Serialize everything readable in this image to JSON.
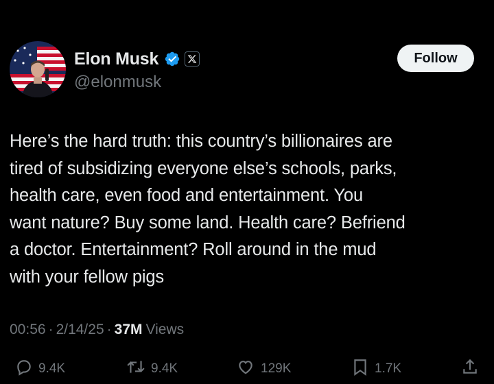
{
  "post": {
    "author": {
      "display_name": "Elon Musk",
      "handle": "@elonmusk",
      "avatar_icon": "avatar-with-flag"
    },
    "badges": {
      "verified_icon": "verified-badge-icon",
      "verified_color": "#1d9bf0",
      "affiliation_icon": "x-logo-icon"
    },
    "follow_label": "Follow",
    "text": "Here’s the hard truth: this country’s billionaires are\ntired of subsidizing everyone else’s schools, parks,\nhealth care, even food and entertainment. You\nwant nature? Buy some land. Health care? Befriend\na doctor. Entertainment? Roll around in the mud\nwith your fellow pigs",
    "meta": {
      "time": "00:56",
      "date": "2/14/25",
      "separator": "·",
      "views_count": "37M",
      "views_label": "Views"
    },
    "actions": {
      "replies": "9.4K",
      "reposts": "9.4K",
      "likes": "129K",
      "bookmarks": "1.7K"
    }
  },
  "colors": {
    "background": "#000000",
    "text_primary": "#e7e9ea",
    "text_secondary": "#71767b",
    "follow_bg": "#eff3f4"
  }
}
